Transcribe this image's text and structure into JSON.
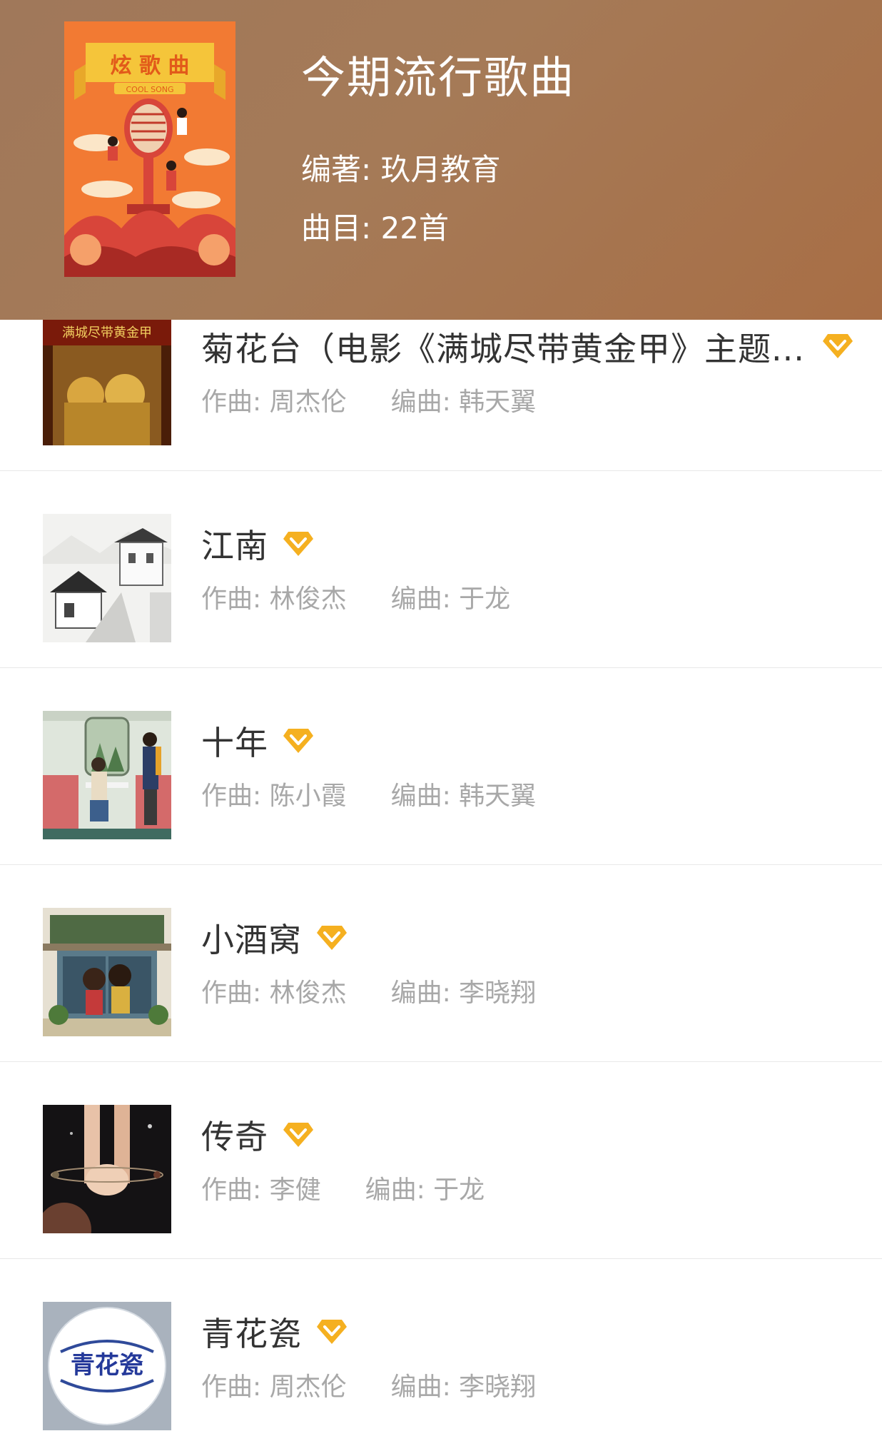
{
  "header": {
    "title": "今期流行歌曲",
    "author": "编著: 玖月教育",
    "track_count": "曲目: 22首",
    "cover": {
      "top_text": "炫 歌 曲",
      "sub_text": "COOL SONG"
    }
  },
  "songs": [
    {
      "title": "菊花台（电影《满城尽带黄金甲》主题...",
      "composer": "作曲: 周杰伦",
      "arranger": "编曲: 韩天翼",
      "thumb_text": "满城尽带黄金甲"
    },
    {
      "title": "江南",
      "composer": "作曲: 林俊杰",
      "arranger": "编曲: 于龙"
    },
    {
      "title": "十年",
      "composer": "作曲: 陈小霞",
      "arranger": "编曲: 韩天翼"
    },
    {
      "title": "小酒窝",
      "composer": "作曲: 林俊杰",
      "arranger": "编曲: 李晓翔"
    },
    {
      "title": "传奇",
      "composer": "作曲: 李健",
      "arranger": "编曲: 于龙"
    },
    {
      "title": "青花瓷",
      "composer": "作曲: 周杰伦",
      "arranger": "编曲: 李晓翔",
      "thumb_text": "青花瓷"
    }
  ],
  "colors": {
    "header_bg": "#a67b57",
    "vip_badge": "#f5b020",
    "title_text": "#333333",
    "meta_text": "#a8a8a8",
    "divider": "#e8e8e8"
  }
}
